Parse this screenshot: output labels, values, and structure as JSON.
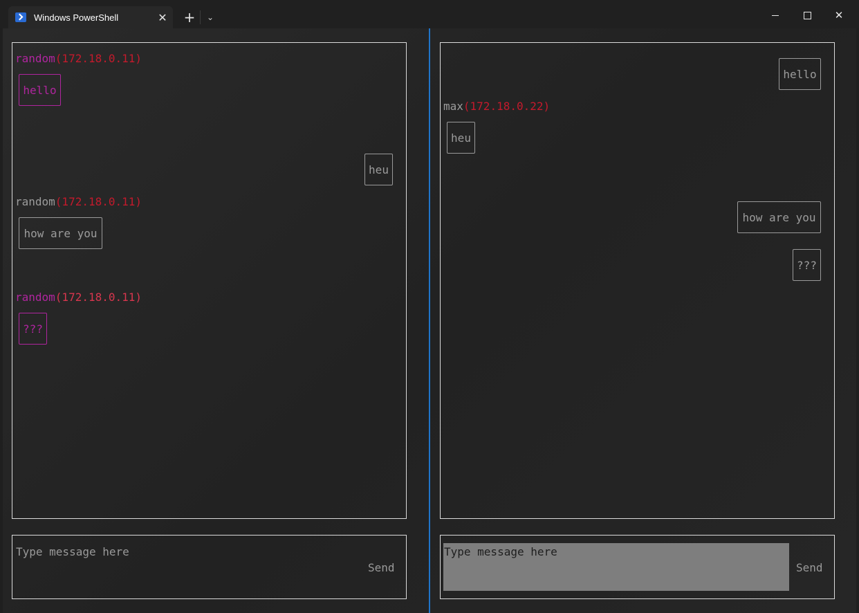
{
  "window": {
    "tab_title": "Windows PowerShell",
    "tab_close": "✕",
    "new_tab": "+",
    "dropdown": "⌄",
    "close": "✕"
  },
  "colors": {
    "accent_divider": "#1f74c9",
    "ip": "#c41a2c",
    "magenta": "#b0259f",
    "gray": "#9a9a9a"
  },
  "left_pane": {
    "messages": [
      {
        "name": "random",
        "ip": "(172.18.0.11)",
        "text": "hello"
      },
      {
        "text": "heu"
      },
      {
        "name": "random",
        "ip": "(172.18.0.11)",
        "text": "how are you"
      },
      {
        "name": "random",
        "ip": "(172.18.0.11)",
        "text": "???"
      }
    ],
    "input": {
      "placeholder": "Type message here",
      "send": "Send"
    }
  },
  "right_pane": {
    "messages": [
      {
        "text": "hello"
      },
      {
        "name": "max",
        "ip": "(172.18.0.22)",
        "text": "heu"
      },
      {
        "text": "how are you"
      },
      {
        "text": "???"
      }
    ],
    "input": {
      "placeholder": "Type message here",
      "send": "Send"
    }
  }
}
